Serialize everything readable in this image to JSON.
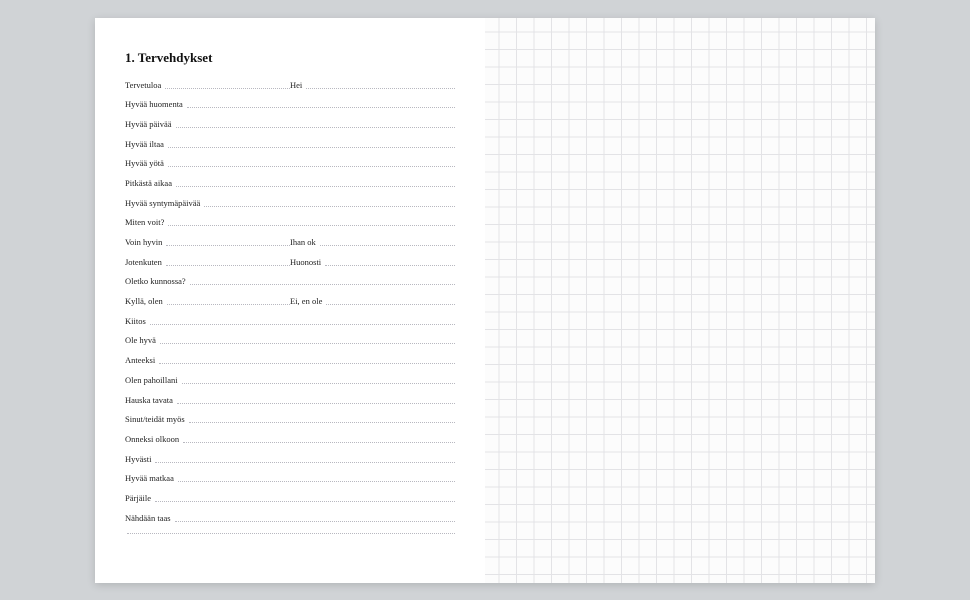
{
  "heading": "1. Tervehdykset",
  "rows": [
    {
      "cells": [
        "Tervetuloa",
        "Hei"
      ]
    },
    {
      "cells": [
        "Hyvää huomenta"
      ]
    },
    {
      "cells": [
        "Hyvää päivää"
      ]
    },
    {
      "cells": [
        "Hyvää iltaa"
      ]
    },
    {
      "cells": [
        "Hyvää yötä"
      ]
    },
    {
      "cells": [
        "Pitkästä aikaa"
      ]
    },
    {
      "cells": [
        "Hyvää syntymäpäivää"
      ]
    },
    {
      "cells": [
        "Miten voit?"
      ]
    },
    {
      "cells": [
        "Voin hyvin",
        "Ihan ok"
      ]
    },
    {
      "cells": [
        "Jotenkuten",
        "Huonosti"
      ]
    },
    {
      "cells": [
        "Oletko kunnossa?"
      ]
    },
    {
      "cells": [
        "Kyllä, olen",
        "Ei, en ole"
      ]
    },
    {
      "cells": [
        "Kiitos"
      ]
    },
    {
      "cells": [
        "Ole hyvä"
      ]
    },
    {
      "cells": [
        "Anteeksi"
      ]
    },
    {
      "cells": [
        "Olen pahoillani"
      ]
    },
    {
      "cells": [
        "Hauska tavata"
      ]
    },
    {
      "cells": [
        "Sinut/teidät myös"
      ]
    },
    {
      "cells": [
        "Onneksi olkoon"
      ]
    },
    {
      "cells": [
        "Hyvästi"
      ]
    },
    {
      "cells": [
        "Hyvää matkaa"
      ]
    },
    {
      "cells": [
        "Pärjäile"
      ]
    },
    {
      "cells": [
        "Nähdään taas"
      ]
    },
    {
      "cells": [
        ""
      ]
    }
  ]
}
